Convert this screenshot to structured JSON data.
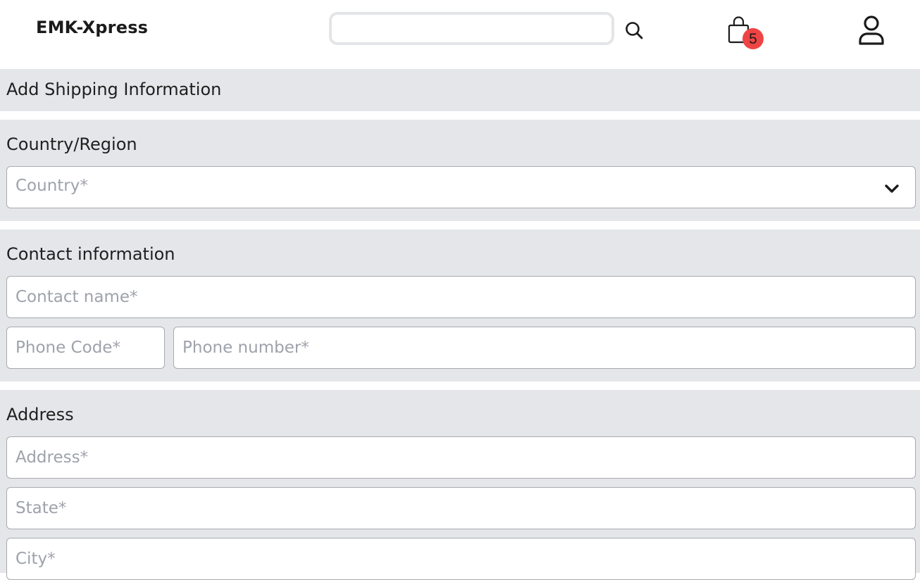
{
  "header": {
    "brand": "EMK-Xpress",
    "search": {
      "value": "",
      "placeholder": ""
    },
    "search_icon": "search-icon",
    "cart": {
      "icon": "shopping-bag-icon",
      "count": "5",
      "badge_color": "#ef4444"
    },
    "user_icon": "user-icon"
  },
  "page": {
    "title": "Add Shipping Information"
  },
  "country_section": {
    "label": "Country/Region",
    "country_select": {
      "placeholder": "Country*",
      "value": ""
    },
    "chevron_icon": "chevron-down-icon"
  },
  "contact_section": {
    "label": "Contact information",
    "contact_name": {
      "placeholder": "Contact name*",
      "value": ""
    },
    "phone_code": {
      "placeholder": "Phone Code*",
      "value": ""
    },
    "phone_number": {
      "placeholder": "Phone number*",
      "value": ""
    }
  },
  "address_section": {
    "label": "Address",
    "address": {
      "placeholder": "Address*",
      "value": ""
    },
    "state": {
      "placeholder": "State*",
      "value": ""
    },
    "city": {
      "placeholder": "City*",
      "value": ""
    }
  },
  "colors": {
    "section_background": "#e5e6e9",
    "field_border": "#a9aab0",
    "placeholder_text": "#9ea2ab"
  }
}
